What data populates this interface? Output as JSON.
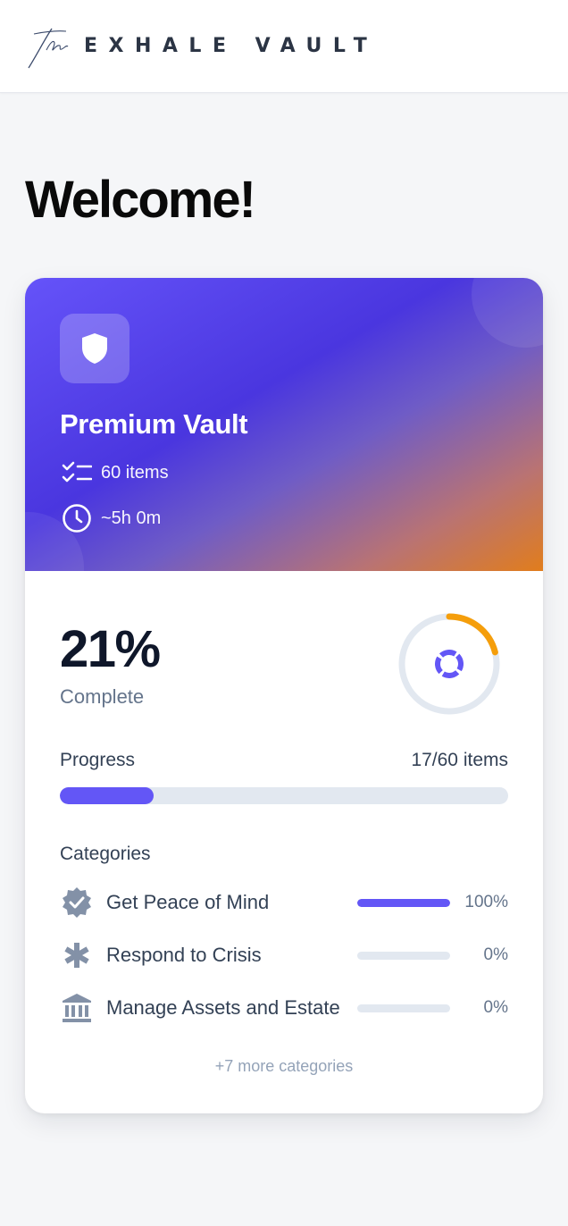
{
  "brand": {
    "script": "the",
    "name": "EXHALE VAULT"
  },
  "welcome": "Welcome!",
  "vault": {
    "title": "Premium Vault",
    "items": "60 items",
    "duration": "~5h 0m",
    "icon": "shield-icon"
  },
  "progress": {
    "percent_text": "21%",
    "complete_label": "Complete",
    "label": "Progress",
    "count": "17/60 items",
    "fraction": 0.21
  },
  "categories": {
    "title": "Categories",
    "items": [
      {
        "name": "Get Peace of Mind",
        "percent": "100%",
        "fraction": 1.0,
        "icon": "verified-badge-icon"
      },
      {
        "name": "Respond to Crisis",
        "percent": "0%",
        "fraction": 0.0,
        "icon": "asterisk-icon"
      },
      {
        "name": "Manage Assets and Estate",
        "percent": "0%",
        "fraction": 0.0,
        "icon": "bank-icon"
      }
    ],
    "more": "+7 more categories"
  },
  "colors": {
    "accent": "#6356f6",
    "ring_accent": "#f59e0b",
    "track": "#e2e8f0",
    "muted_icon": "#8391a7"
  }
}
